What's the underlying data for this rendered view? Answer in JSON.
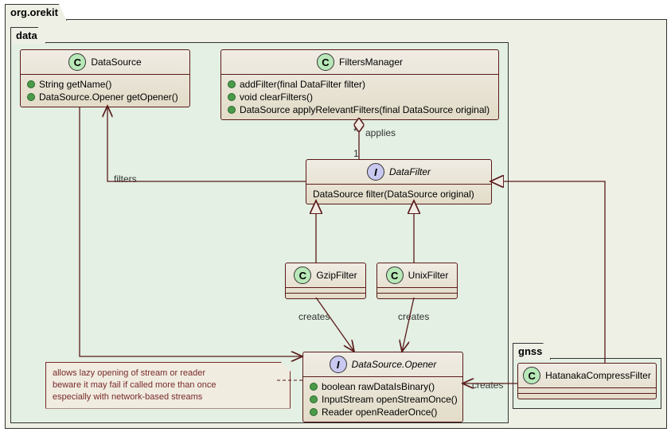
{
  "outerPackage": "org.orekit",
  "dataPackage": "data",
  "gnssPackage": "gnss",
  "dataSource": {
    "name": "DataSource",
    "m1": "String getName()",
    "m2": "DataSource.Opener getOpener()"
  },
  "filtersManager": {
    "name": "FiltersManager",
    "m1": "addFilter(final DataFilter filter)",
    "m2": "void clearFilters()",
    "m3": "DataSource applyRelevantFilters(final DataSource original)"
  },
  "dataFilter": {
    "name": "DataFilter",
    "m1": "DataSource filter(DataSource original)"
  },
  "gzipFilter": {
    "name": "GzipFilter"
  },
  "unixFilter": {
    "name": "UnixFilter"
  },
  "opener": {
    "name": "DataSource.Opener",
    "m1": "boolean rawDataIsBinary()",
    "m2": "InputStream openStreamOnce()",
    "m3": "Reader      openReaderOnce()"
  },
  "hatanaka": {
    "name": "HatanakaCompressFilter"
  },
  "labels": {
    "applies": "applies",
    "filters": "filters",
    "creates": "creates",
    "star": "*",
    "one": "1"
  },
  "note": {
    "l1": "allows lazy opening of stream or reader",
    "l2": "beware it may fail if called more than once",
    "l3": "especially with network-based streams"
  },
  "chart_data": {
    "type": "table",
    "uml_kind": "class-diagram",
    "packages": [
      {
        "name": "org.orekit",
        "contains": [
          "data",
          "gnss"
        ]
      },
      {
        "name": "data",
        "contains": [
          "DataSource",
          "FiltersManager",
          "DataFilter",
          "GzipFilter",
          "UnixFilter",
          "DataSource.Opener"
        ]
      },
      {
        "name": "gnss",
        "contains": [
          "HatanakaCompressFilter"
        ]
      }
    ],
    "classes": [
      {
        "name": "DataSource",
        "stereotype": "class",
        "methods": [
          "String getName()",
          "DataSource.Opener getOpener()"
        ]
      },
      {
        "name": "FiltersManager",
        "stereotype": "class",
        "methods": [
          "addFilter(final DataFilter filter)",
          "void clearFilters()",
          "DataSource applyRelevantFilters(final DataSource original)"
        ]
      },
      {
        "name": "DataFilter",
        "stereotype": "interface",
        "methods": [
          "DataSource filter(DataSource original)"
        ]
      },
      {
        "name": "GzipFilter",
        "stereotype": "class"
      },
      {
        "name": "UnixFilter",
        "stereotype": "class"
      },
      {
        "name": "DataSource.Opener",
        "stereotype": "interface",
        "methods": [
          "boolean rawDataIsBinary()",
          "InputStream openStreamOnce()",
          "Reader openReaderOnce()"
        ]
      },
      {
        "name": "HatanakaCompressFilter",
        "stereotype": "class"
      }
    ],
    "relationships": [
      {
        "from": "FiltersManager",
        "to": "DataFilter",
        "type": "aggregation",
        "label": "applies",
        "multiplicity_from": "*",
        "multiplicity_to": "1"
      },
      {
        "from": "DataFilter",
        "to": "DataSource",
        "type": "association",
        "label": "filters",
        "arrow": "open"
      },
      {
        "from": "GzipFilter",
        "to": "DataFilter",
        "type": "realization"
      },
      {
        "from": "UnixFilter",
        "to": "DataFilter",
        "type": "realization"
      },
      {
        "from": "HatanakaCompressFilter",
        "to": "DataFilter",
        "type": "realization"
      },
      {
        "from": "GzipFilter",
        "to": "DataSource.Opener",
        "type": "dependency",
        "label": "creates"
      },
      {
        "from": "UnixFilter",
        "to": "DataSource.Opener",
        "type": "dependency",
        "label": "creates"
      },
      {
        "from": "HatanakaCompressFilter",
        "to": "DataSource.Opener",
        "type": "dependency",
        "label": "creates"
      },
      {
        "from": "DataSource",
        "to": "DataSource.Opener",
        "type": "association",
        "arrow": "open"
      }
    ],
    "note": "allows lazy opening of stream or reader\nbeware it may fail if called more than once\nespecially with network-based streams"
  }
}
